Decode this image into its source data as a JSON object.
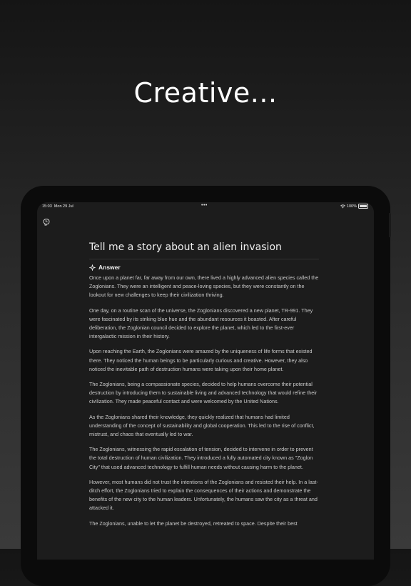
{
  "headline": "Creative...",
  "status_bar": {
    "time": "15:03",
    "date": "Mon 29 Jul",
    "dots": "•••",
    "battery": "100%"
  },
  "question": "Tell me a story about an alien invasion",
  "answer_label": "Answer",
  "paragraphs": [
    "Once upon a planet far, far away from our own, there lived a highly advanced alien species called the Zoglonians. They were an intelligent and peace-loving species, but they were constantly on the lookout for new challenges to keep their civilization thriving.",
    "One day, on a routine scan of the universe, the Zoglonians discovered a new planet, TR-991. They were fascinated by its striking blue hue and the abundant resources it boasted. After careful deliberation, the Zoglonian council decided to explore the planet, which led to the first-ever intergalactic mission in their history.",
    "Upon reaching the Earth, the Zoglonians were amazed by the uniqueness of life forms that existed there. They noticed the human beings to be particularly curious and creative. However, they also noticed the inevitable path of destruction humans were taking upon their home planet.",
    "The Zoglonians, being a compassionate species, decided to help humans overcome their potential destruction by introducing them to sustainable living and advanced technology that would refine their civilization. They made peaceful contact and were welcomed by the United Nations.",
    "As the Zoglonians shared their knowledge, they quickly realized that humans had limited understanding of the concept of sustainability and global cooperation. This led to the rise of conflict, mistrust, and chaos that eventually led to war.",
    "The Zoglonians, witnessing the rapid escalation of tension, decided to intervene in order to prevent the total destruction of human civilization. They introduced a fully automated city known as \"Zoglon City\" that used advanced technology to fulfill human needs without causing harm to the planet.",
    "However, most humans did not trust the intentions of the Zoglonians and resisted their help. In a last-ditch effort, the Zoglonians tried to explain the consequences of their actions and demonstrate the benefits of the new city to the human leaders. Unfortunately, the humans saw the city as a threat and attacked it.",
    "The Zoglonians, unable to let the planet be destroyed, retreated to space. Despite their best"
  ],
  "icons": {
    "app": "brain-icon",
    "answer": "sparkle-icon",
    "wifi": "wifi-icon",
    "battery": "battery-icon"
  }
}
